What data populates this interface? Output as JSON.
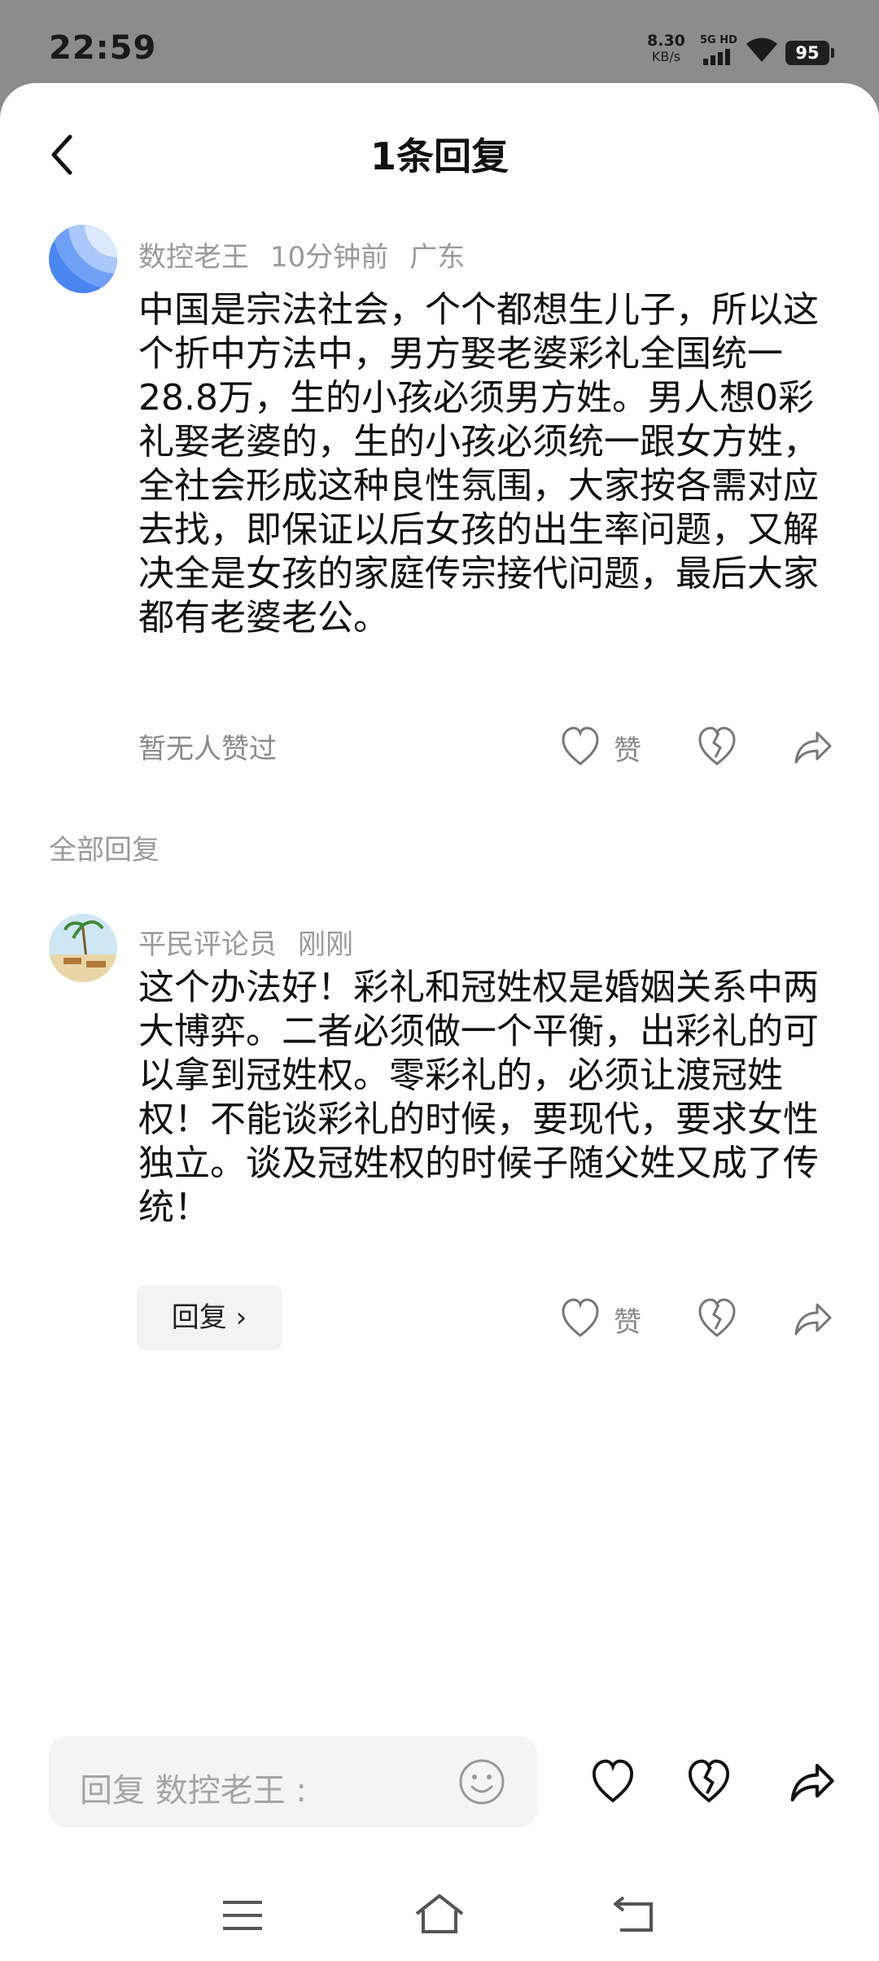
{
  "status": {
    "time": "22:59",
    "net_speed_value": "8.30",
    "net_speed_unit": "KB/s",
    "signal_label": "5G HD",
    "battery": "95"
  },
  "header": {
    "title": "1条回复",
    "back_icon": "chevron-left-icon"
  },
  "main_comment": {
    "author": "数控老王",
    "time": "10分钟前",
    "location": "广东",
    "text": "中国是宗法社会，个个都想生儿子，所以这个折中方法中，男方娶老婆彩礼全国统一28.8万，生的小孩必须男方姓。男人想0彩礼娶老婆的，生的小孩必须统一跟女方姓，全社会形成这种良性氛围，大家按各需对应去找，即保证以后女孩的出生率问题，又解决全是女孩的家庭传宗接代问题，最后大家都有老婆老公。",
    "likes_text": "暂无人赞过",
    "like_label": "赞"
  },
  "section": {
    "title": "全部回复"
  },
  "replies": [
    {
      "author": "平民评论员",
      "time": "刚刚",
      "text": "这个办法好！彩礼和冠姓权是婚姻关系中两大博弈。二者必须做一个平衡，出彩礼的可以拿到冠姓权。零彩礼的，必须让渡冠姓权！不能谈彩礼的时候，要现代，要求女性独立。谈及冠姓权的时候子随父姓又成了传统！",
      "reply_button": "回复 ›",
      "like_label": "赞"
    }
  ],
  "bottom_bar": {
    "placeholder": "回复 数控老王 :"
  },
  "colors": {
    "sheet_bg": "#ffffff",
    "overlay_bg": "#8c8c8c",
    "muted_text": "#9a9a9a"
  }
}
